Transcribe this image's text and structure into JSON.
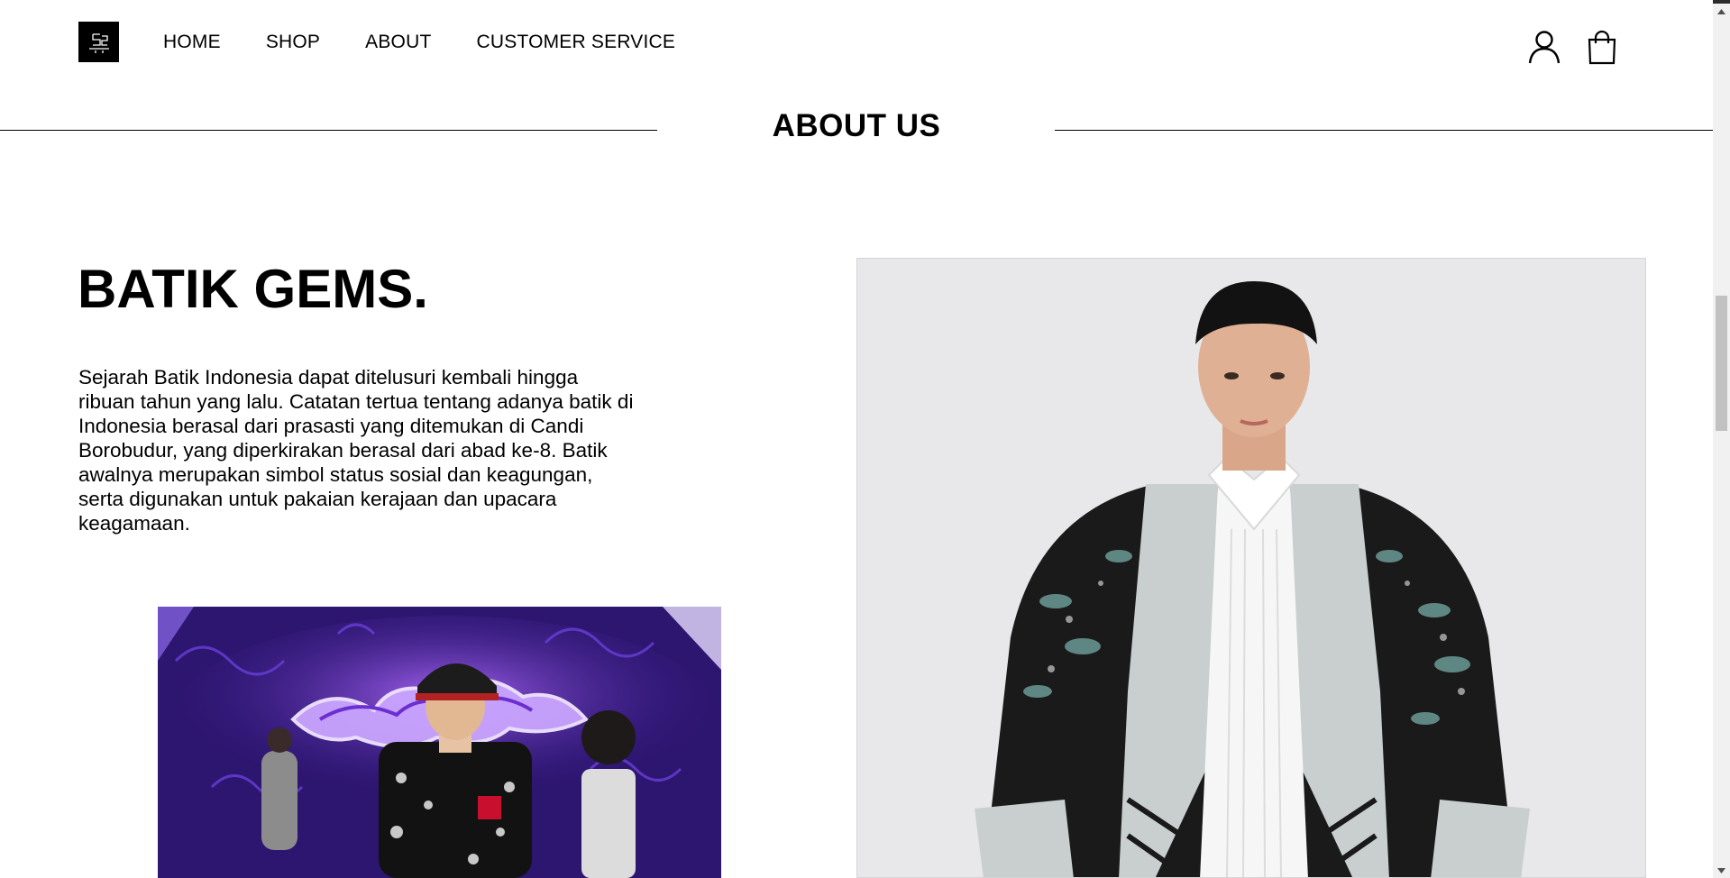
{
  "header": {
    "logo_icon": "batik-gems-logo",
    "nav": [
      {
        "label": "HOME"
      },
      {
        "label": "SHOP"
      },
      {
        "label": "ABOUT"
      },
      {
        "label": "CUSTOMER SERVICE"
      }
    ],
    "icons": [
      "user-icon",
      "shopping-bag-icon"
    ]
  },
  "section": {
    "title": "ABOUT US"
  },
  "content": {
    "brand_title": "BATIK GEMS.",
    "paragraph": "Sejarah Batik Indonesia dapat ditelusuri kembali hingga ribuan tahun yang lalu. Catatan tertua tentang adanya batik di Indonesia berasal dari prasasti yang ditemukan di Candi Borobudur, yang diperkirakan berasal dari abad ke-8. Batik awalnya merupakan simbol status sosial dan keagungan, serta digunakan untuk pakaian kerajaan dan upacara keagamaan."
  },
  "colors": {
    "text": "#000000",
    "background": "#ffffff",
    "top_bar": "#2b2b2b",
    "scrollbar_track": "#f1f1f1",
    "scrollbar_thumb": "#c1c1c1"
  }
}
